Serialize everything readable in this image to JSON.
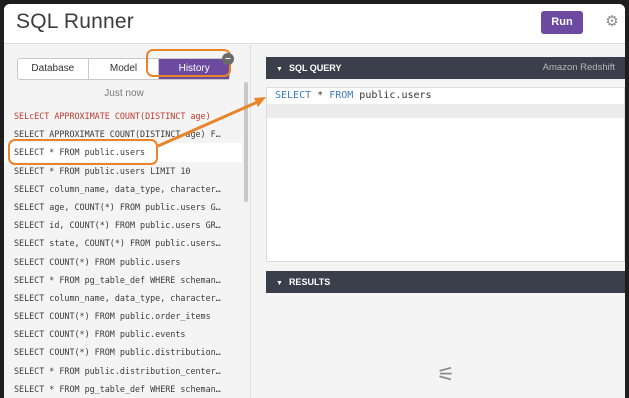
{
  "header": {
    "title": "SQL Runner",
    "run_label": "Run",
    "settings_icon": "gear-icon"
  },
  "tabs": [
    {
      "label": "Database",
      "active": false
    },
    {
      "label": "Model",
      "active": false
    },
    {
      "label": "History",
      "active": true
    }
  ],
  "history": {
    "timestamp": "Just now",
    "items": [
      {
        "text": "SELcECT APPROXIMATE COUNT(DISTINCT age)",
        "status": "error"
      },
      {
        "text": "SELECT APPROXIMATE COUNT(DISTINCT age) F…",
        "status": "ok"
      },
      {
        "text": "SELECT * FROM public.users",
        "status": "selected"
      },
      {
        "text": "SELECT * FROM public.users LIMIT 10",
        "status": "ok"
      },
      {
        "text": "SELECT column_name, data_type, character…",
        "status": "ok"
      },
      {
        "text": "SELECT age, COUNT(*) FROM public.users G…",
        "status": "ok"
      },
      {
        "text": "SELECT id, COUNT(*) FROM public.users GR…",
        "status": "ok"
      },
      {
        "text": "SELECT state, COUNT(*) FROM public.users…",
        "status": "ok"
      },
      {
        "text": "SELECT COUNT(*) FROM public.users",
        "status": "ok"
      },
      {
        "text": "SELECT * FROM pg_table_def WHERE scheman…",
        "status": "ok"
      },
      {
        "text": "SELECT column_name, data_type, character…",
        "status": "ok"
      },
      {
        "text": "SELECT COUNT(*) FROM public.order_items",
        "status": "ok"
      },
      {
        "text": "SELECT COUNT(*) FROM public.events",
        "status": "ok"
      },
      {
        "text": "SELECT COUNT(*) FROM public.distribution…",
        "status": "ok"
      },
      {
        "text": "SELECT * FROM public.distribution_center…",
        "status": "ok"
      },
      {
        "text": "SELECT * FROM pg_table_def WHERE scheman…",
        "status": "ok"
      }
    ]
  },
  "sql_query": {
    "section_label": "SQL QUERY",
    "engine": "Amazon Redshift",
    "query": {
      "kw1": "SELECT",
      "star": " * ",
      "kw2": "FROM",
      "rest": " public.users"
    }
  },
  "results": {
    "section_label": "RESULTS"
  },
  "colors": {
    "accent": "#6b4aa0",
    "highlight": "#e8852b",
    "section_bar": "#3b3f4b",
    "error_text": "#c23a2e"
  }
}
